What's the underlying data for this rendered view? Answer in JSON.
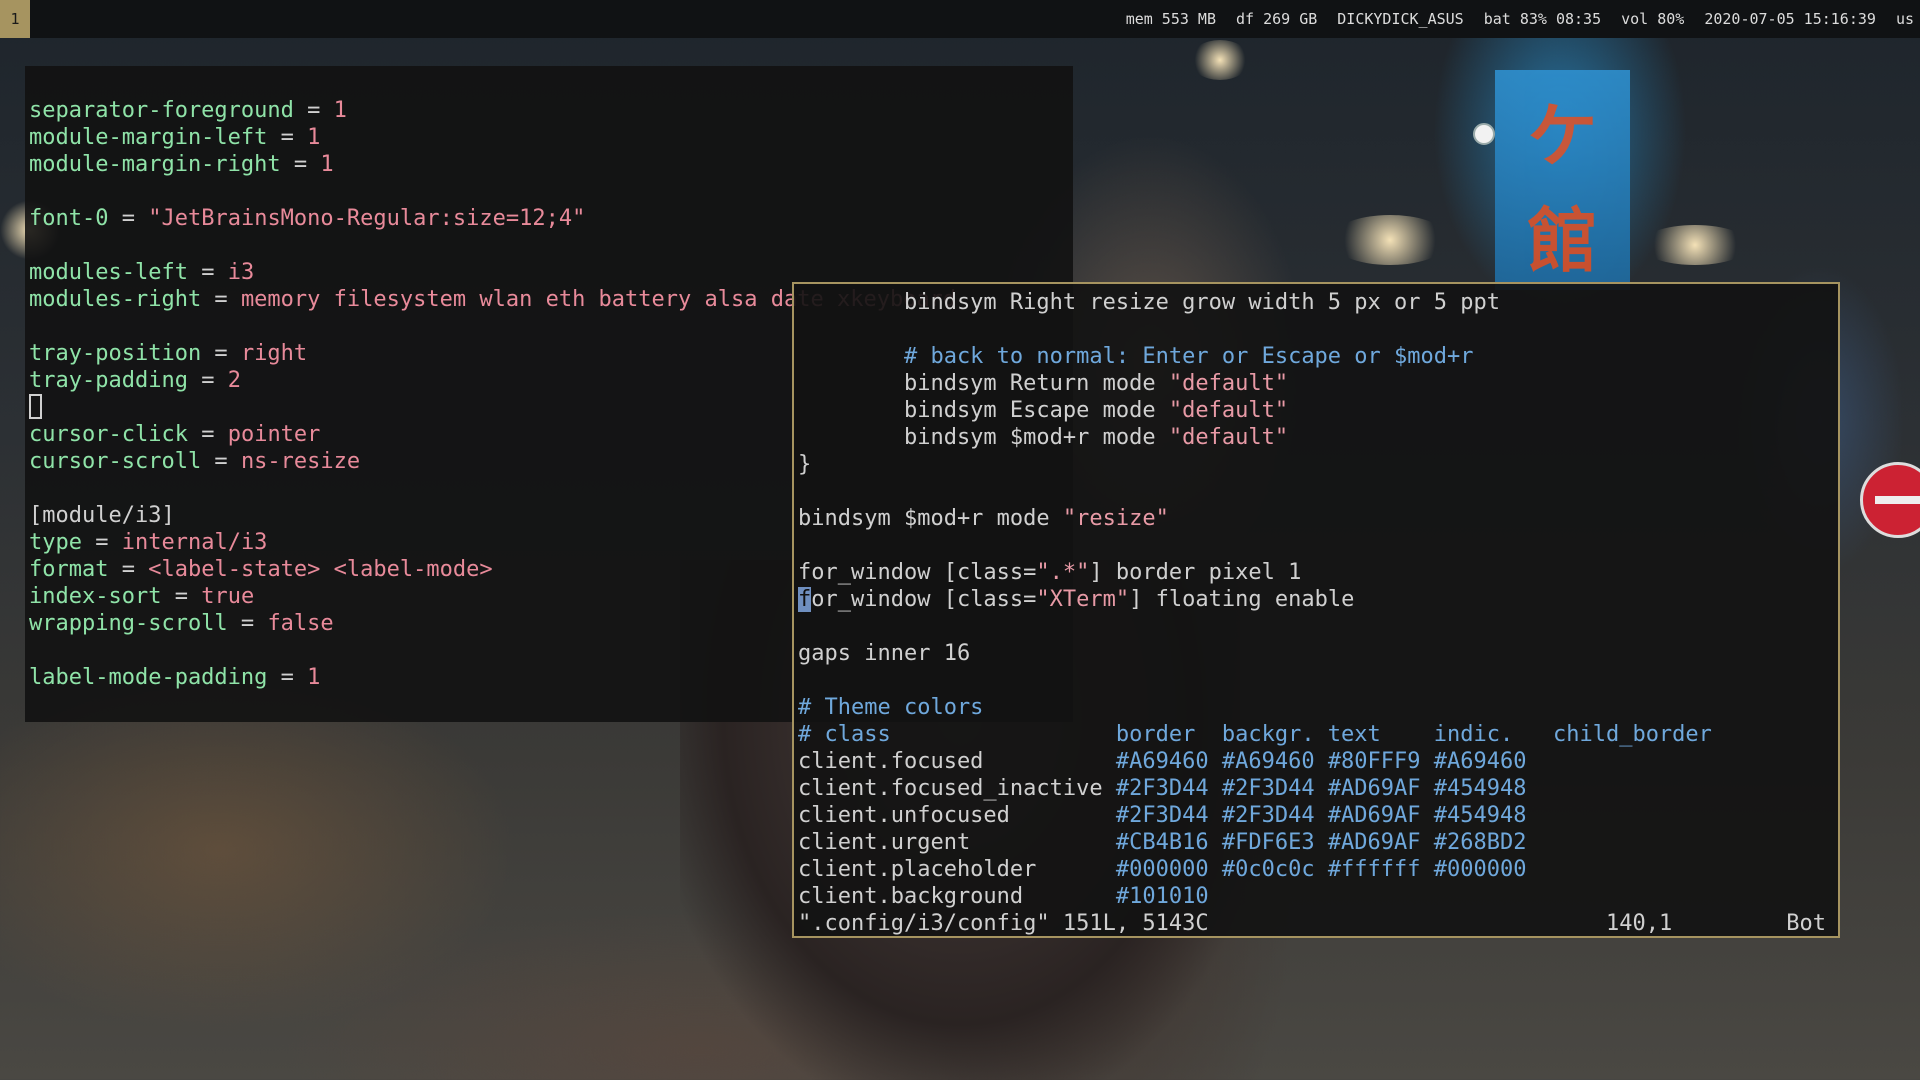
{
  "topbar": {
    "workspace": "1",
    "modules": [
      "mem 553 MB",
      "df 269 GB",
      "DICKYDICK_ASUS",
      "bat 83% 08:35",
      "vol 80%",
      "2020-07-05 15:16:39",
      "us"
    ]
  },
  "wallpaper": {
    "sign_chars": [
      "ケ",
      "館"
    ]
  },
  "left_terminal": {
    "lines": [
      {
        "k": "separator-foreground",
        "eq": " = ",
        "v": "1"
      },
      {
        "k": "module-margin-left",
        "eq": " = ",
        "v": "1"
      },
      {
        "k": "module-margin-right",
        "eq": " = ",
        "v": "1"
      },
      {
        "k": "",
        "eq": "",
        "v": ""
      },
      {
        "k": "font-0",
        "eq": " = ",
        "v": "\"JetBrainsMono-Regular:size=12;4\""
      },
      {
        "k": "",
        "eq": "",
        "v": ""
      },
      {
        "k": "modules-left",
        "eq": " = ",
        "v": "i3"
      },
      {
        "k": "modules-right",
        "eq": " = ",
        "v": "memory filesystem wlan eth battery alsa date xkeyboard"
      },
      {
        "k": "",
        "eq": "",
        "v": ""
      },
      {
        "k": "tray-position",
        "eq": " = ",
        "v": "right"
      },
      {
        "k": "tray-padding",
        "eq": " = ",
        "v": "2"
      },
      {
        "k": "",
        "eq": "",
        "v": ""
      },
      {
        "k": "cursor-click",
        "eq": " = ",
        "v": "pointer"
      },
      {
        "k": "cursor-scroll",
        "eq": " = ",
        "v": "ns-resize"
      },
      {
        "k": "",
        "eq": "",
        "v": ""
      },
      {
        "k": "",
        "eq": "",
        "v": "[module/i3]"
      },
      {
        "k": "type",
        "eq": " = ",
        "v": "internal/i3"
      },
      {
        "k": "format",
        "eq": " = ",
        "v": "<label-state> <label-mode>"
      },
      {
        "k": "index-sort",
        "eq": " = ",
        "v": "true"
      },
      {
        "k": "wrapping-scroll",
        "eq": " = ",
        "v": "false"
      },
      {
        "k": "",
        "eq": "",
        "v": ""
      },
      {
        "k": "label-mode-padding",
        "eq": " = ",
        "v": "1"
      }
    ],
    "faded_percent": "12%"
  },
  "right_terminal": {
    "lines": [
      [
        {
          "t": "        bindsym Right resize grow width 5 px or 5 ppt",
          "c": "plain"
        }
      ],
      [
        {
          "t": "",
          "c": "plain"
        }
      ],
      [
        {
          "t": "        # back to normal: Enter or Escape or $mod+r",
          "c": "com"
        }
      ],
      [
        {
          "t": "        bindsym Return mode ",
          "c": "plain"
        },
        {
          "t": "\"default\"",
          "c": "str"
        }
      ],
      [
        {
          "t": "        bindsym Escape mode ",
          "c": "plain"
        },
        {
          "t": "\"default\"",
          "c": "str"
        }
      ],
      [
        {
          "t": "        bindsym $mod+r mode ",
          "c": "plain"
        },
        {
          "t": "\"default\"",
          "c": "str"
        }
      ],
      [
        {
          "t": "}",
          "c": "plain"
        }
      ],
      [
        {
          "t": "",
          "c": "plain"
        }
      ],
      [
        {
          "t": "bindsym $mod+r mode ",
          "c": "plain"
        },
        {
          "t": "\"resize\"",
          "c": "str"
        }
      ],
      [
        {
          "t": "",
          "c": "plain"
        }
      ],
      [
        {
          "t": "for_window [class=",
          "c": "plain"
        },
        {
          "t": "\".*\"",
          "c": "str"
        },
        {
          "t": "] border pixel 1",
          "c": "plain"
        }
      ],
      [
        {
          "t": "f",
          "c": "cursor"
        },
        {
          "t": "or_window [class=",
          "c": "plain"
        },
        {
          "t": "\"XTerm\"",
          "c": "str"
        },
        {
          "t": "] floating enable",
          "c": "plain"
        }
      ],
      [
        {
          "t": "",
          "c": "plain"
        }
      ],
      [
        {
          "t": "gaps inner 16",
          "c": "plain"
        }
      ],
      [
        {
          "t": "",
          "c": "plain"
        }
      ],
      [
        {
          "t": "# Theme colors",
          "c": "com"
        }
      ],
      [
        {
          "t": "# class                 border  backgr. text    indic.   child_border",
          "c": "com"
        }
      ],
      [
        {
          "t": "client.focused          ",
          "c": "plain"
        },
        {
          "t": "#A69460 #A69460 #80FFF9 #A69460",
          "c": "hex"
        }
      ],
      [
        {
          "t": "client.focused_inactive ",
          "c": "plain"
        },
        {
          "t": "#2F3D44 #2F3D44 #AD69AF #454948",
          "c": "hex"
        }
      ],
      [
        {
          "t": "client.unfocused        ",
          "c": "plain"
        },
        {
          "t": "#2F3D44 #2F3D44 #AD69AF #454948",
          "c": "hex"
        }
      ],
      [
        {
          "t": "client.urgent           ",
          "c": "plain"
        },
        {
          "t": "#CB4B16 #FDF6E3 #AD69AF #268BD2",
          "c": "hex"
        }
      ],
      [
        {
          "t": "client.placeholder      ",
          "c": "plain"
        },
        {
          "t": "#000000 #0c0c0c #ffffff #000000",
          "c": "hex"
        }
      ],
      [
        {
          "t": "client.background       ",
          "c": "plain"
        },
        {
          "t": "#101010",
          "c": "hex"
        }
      ]
    ],
    "status": {
      "file": "\".config/i3/config\" 151L, 5143C",
      "position": "140,1",
      "scroll": "Bot"
    }
  },
  "colors": {
    "accent_border": "#A69460",
    "key_green": "#8fe3a8",
    "value_pink": "#e88a9a",
    "comment_blue": "#6fa8dc"
  }
}
